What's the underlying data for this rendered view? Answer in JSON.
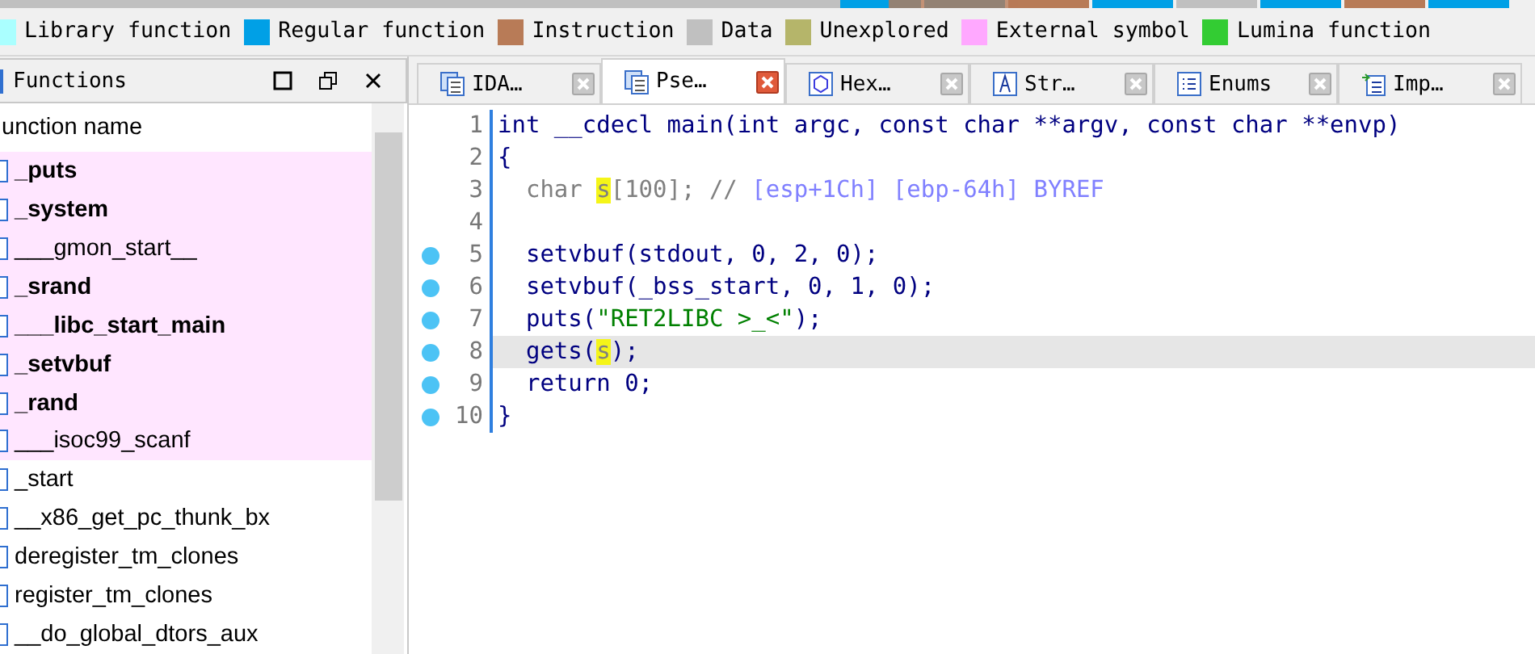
{
  "legend": [
    {
      "label": "Library function",
      "color": "#aaffff"
    },
    {
      "label": "Regular function",
      "color": "#00a0e6"
    },
    {
      "label": "Instruction",
      "color": "#b87b57"
    },
    {
      "label": "Data",
      "color": "#c0c0c0"
    },
    {
      "label": "Unexplored",
      "color": "#b5b56a"
    },
    {
      "label": "External symbol",
      "color": "#ffa8ff"
    },
    {
      "label": "Lumina function",
      "color": "#33cc33"
    }
  ],
  "functions_panel": {
    "title": "Functions",
    "column": "unction name",
    "rows": [
      {
        "name": "_puts",
        "bold": true,
        "external": true
      },
      {
        "name": "_system",
        "bold": true,
        "external": true
      },
      {
        "name": "___gmon_start__",
        "bold": false,
        "external": true
      },
      {
        "name": "_srand",
        "bold": true,
        "external": true
      },
      {
        "name": "___libc_start_main",
        "bold": true,
        "external": true
      },
      {
        "name": "_setvbuf",
        "bold": true,
        "external": true
      },
      {
        "name": "_rand",
        "bold": true,
        "external": true
      },
      {
        "name": "___isoc99_scanf",
        "bold": false,
        "external": true
      },
      {
        "name": "_start",
        "bold": false,
        "external": false
      },
      {
        "name": "__x86_get_pc_thunk_bx",
        "bold": false,
        "external": false
      },
      {
        "name": "deregister_tm_clones",
        "bold": false,
        "external": false
      },
      {
        "name": "register_tm_clones",
        "bold": false,
        "external": false
      },
      {
        "name": "__do_global_dtors_aux",
        "bold": false,
        "external": false
      }
    ]
  },
  "tabs": [
    {
      "label": "IDA…",
      "kind": "view",
      "selected": false
    },
    {
      "label": "Pse…",
      "kind": "view",
      "selected": true
    },
    {
      "label": "Hex…",
      "kind": "hex",
      "selected": false
    },
    {
      "label": "Str…",
      "kind": "str",
      "selected": false
    },
    {
      "label": "Enums",
      "kind": "list",
      "selected": false
    },
    {
      "label": "Imp…",
      "kind": "import",
      "selected": false
    }
  ],
  "code": [
    {
      "number": "1",
      "breakpoint": false,
      "selected": false,
      "tokens": [
        {
          "text": "int __cdecl main(int argc, const char **argv, const char **envp)",
          "kind": "head"
        }
      ]
    },
    {
      "number": "2",
      "breakpoint": false,
      "selected": false,
      "tokens": [
        {
          "text": "{",
          "kind": "head"
        }
      ]
    },
    {
      "number": "3",
      "breakpoint": false,
      "selected": false,
      "tokens": [
        {
          "text": "  char ",
          "kind": "decl"
        },
        {
          "text": "s",
          "kind": "mark"
        },
        {
          "text": "[100]; // ",
          "kind": "decl"
        },
        {
          "text": "[esp+1Ch] [ebp-64h] BYREF",
          "kind": "comment"
        }
      ]
    },
    {
      "number": "4",
      "breakpoint": false,
      "selected": false
    },
    {
      "number": "5",
      "breakpoint": true,
      "selected": false,
      "tokens": [
        {
          "text": "  setvbuf(stdout, 0, 2, 0);",
          "kind": "code"
        }
      ]
    },
    {
      "number": "6",
      "breakpoint": true,
      "selected": false,
      "tokens": [
        {
          "text": "  setvbuf(_bss_start, 0, 1, 0);",
          "kind": "code"
        }
      ]
    },
    {
      "number": "7",
      "breakpoint": true,
      "selected": false,
      "tokens": [
        {
          "text": "  puts(",
          "kind": "code"
        },
        {
          "text": "\"RET2LIBC >_<\"",
          "kind": "string"
        },
        {
          "text": ");",
          "kind": "code"
        }
      ]
    },
    {
      "number": "8",
      "breakpoint": true,
      "selected": true,
      "tokens": [
        {
          "text": "  gets(",
          "kind": "code"
        },
        {
          "text": "s",
          "kind": "mark"
        },
        {
          "text": ");",
          "kind": "code"
        }
      ]
    },
    {
      "number": "9",
      "breakpoint": true,
      "selected": false,
      "tokens": [
        {
          "text": "  return 0;",
          "kind": "code"
        }
      ]
    },
    {
      "number": "10",
      "breakpoint": true,
      "selected": false,
      "tokens": [
        {
          "text": "}",
          "kind": "head"
        }
      ]
    }
  ]
}
